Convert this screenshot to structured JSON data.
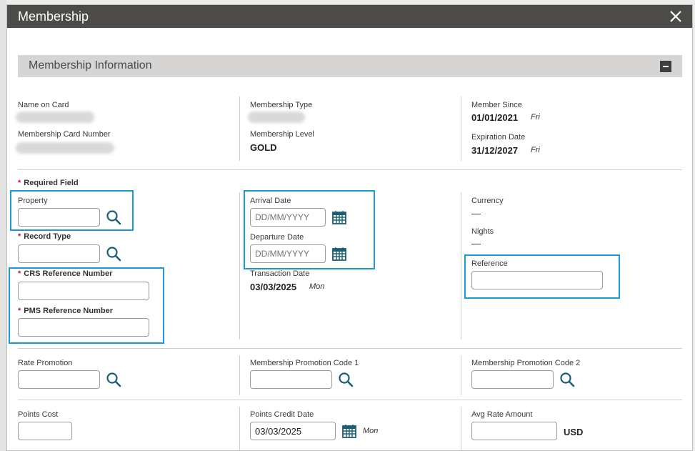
{
  "dialog": {
    "title": "Membership"
  },
  "section": {
    "title": "Membership Information"
  },
  "info": {
    "name_on_card_label": "Name on Card",
    "card_number_label": "Membership Card Number",
    "type_label": "Membership Type",
    "level_label": "Membership Level",
    "level_value": "GOLD",
    "since_label": "Member Since",
    "since_value": "01/01/2021",
    "since_day": "Fri",
    "expiration_label": "Expiration Date",
    "expiration_value": "31/12/2027",
    "expiration_day": "Fri"
  },
  "form": {
    "required_note": "Required Field",
    "required_mark": "*",
    "property_label": "Property",
    "record_type_label": "Record Type",
    "crs_label": "CRS Reference Number",
    "pms_label": "PMS Reference Number",
    "arrival_label": "Arrival Date",
    "arrival_placeholder": "DD/MM/YYYY",
    "departure_label": "Departure Date",
    "departure_placeholder": "DD/MM/YYYY",
    "transaction_label": "Transaction Date",
    "transaction_value": "03/03/2025",
    "transaction_day": "Mon",
    "currency_label": "Currency",
    "currency_value": "—",
    "nights_label": "Nights",
    "nights_value": "—",
    "reference_label": "Reference",
    "rate_promotion_label": "Rate Promotion",
    "promo_code1_label": "Membership Promotion Code 1",
    "promo_code2_label": "Membership Promotion Code 2",
    "points_cost_label": "Points Cost",
    "points_credit_label": "Points Credit Date",
    "points_credit_value": "03/03/2025",
    "points_credit_day": "Mon",
    "avg_rate_label": "Avg Rate Amount",
    "avg_rate_currency": "USD"
  },
  "colors": {
    "titlebar": "#4d4b48",
    "highlight": "#1c9ad6",
    "required": "#c8102e",
    "icon": "#1b5e74"
  }
}
